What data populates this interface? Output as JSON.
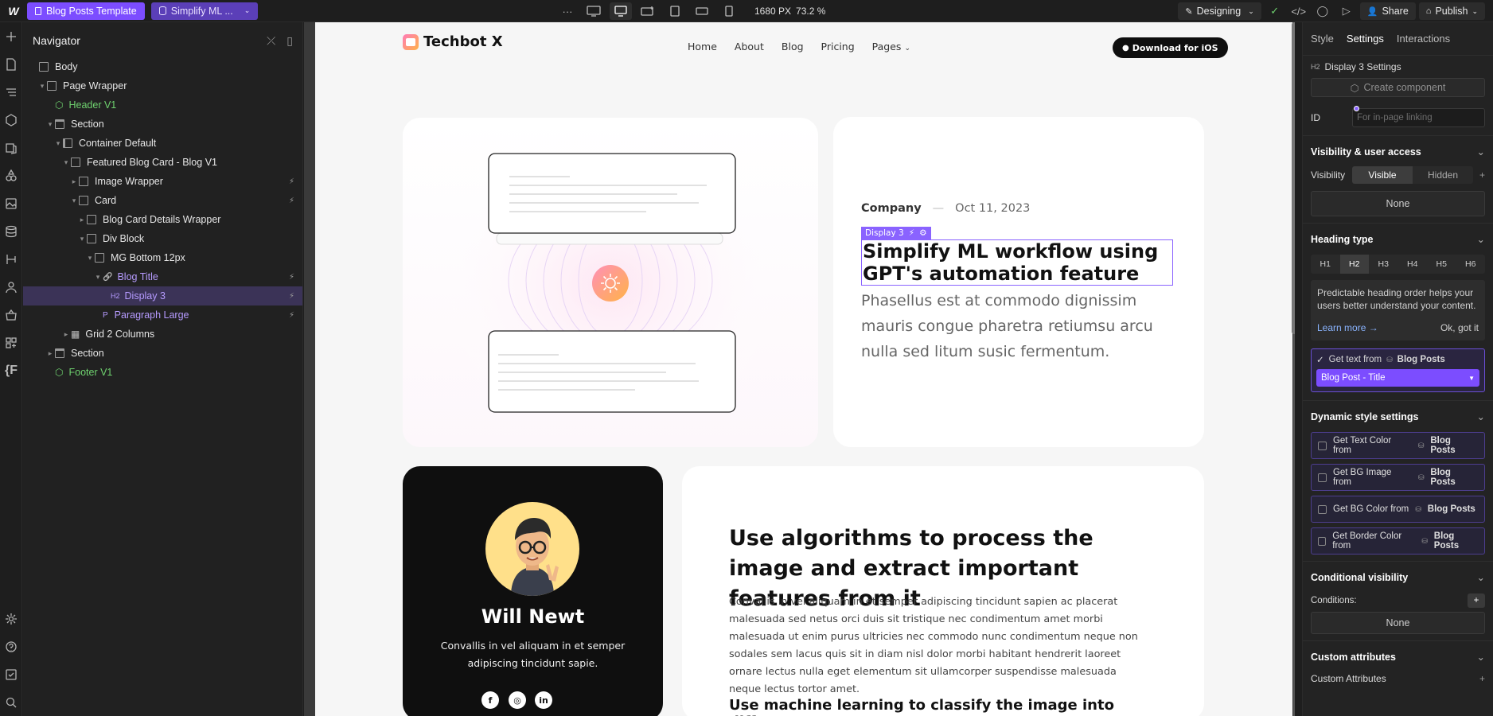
{
  "topbar": {
    "page_name": "Blog Posts Template",
    "collection_name": "Simplify ML ...",
    "more": "···",
    "viewport_width": "1680 PX",
    "zoom": "73.2 %",
    "mode": "Designing",
    "share": "Share",
    "publish": "Publish"
  },
  "navigator": {
    "title": "Navigator",
    "rows": [
      {
        "label": "Body",
        "indent": 0,
        "caret": "",
        "kind": "box",
        "color": "white",
        "bolt": false,
        "selected": false
      },
      {
        "label": "Page Wrapper",
        "indent": 1,
        "caret": "▾",
        "kind": "box",
        "color": "white",
        "bolt": false,
        "selected": false
      },
      {
        "label": "Header V1",
        "indent": 2,
        "caret": "",
        "kind": "component",
        "color": "green",
        "bolt": false,
        "selected": false
      },
      {
        "label": "Section",
        "indent": 2,
        "caret": "▾",
        "kind": "section",
        "color": "white",
        "bolt": false,
        "selected": false
      },
      {
        "label": "Container Default",
        "indent": 3,
        "caret": "▾",
        "kind": "container",
        "color": "white",
        "bolt": false,
        "selected": false
      },
      {
        "label": "Featured Blog Card - Blog V1",
        "indent": 4,
        "caret": "▾",
        "kind": "box",
        "color": "white",
        "bolt": false,
        "selected": false
      },
      {
        "label": "Image Wrapper",
        "indent": 5,
        "caret": "▸",
        "kind": "box",
        "color": "white",
        "bolt": true,
        "selected": false
      },
      {
        "label": "Card",
        "indent": 5,
        "caret": "▾",
        "kind": "box",
        "color": "white",
        "bolt": true,
        "selected": false
      },
      {
        "label": "Blog Card Details Wrapper",
        "indent": 6,
        "caret": "▸",
        "kind": "box",
        "color": "white",
        "bolt": false,
        "selected": false
      },
      {
        "label": "Div Block",
        "indent": 6,
        "caret": "▾",
        "kind": "box",
        "color": "white",
        "bolt": false,
        "selected": false
      },
      {
        "label": "MG Bottom 12px",
        "indent": 7,
        "caret": "▾",
        "kind": "box",
        "color": "white",
        "bolt": false,
        "selected": false
      },
      {
        "label": "Blog Title",
        "indent": 8,
        "caret": "▾",
        "kind": "link",
        "color": "purple",
        "bolt": true,
        "selected": false
      },
      {
        "label": "Display 3",
        "indent": 9,
        "caret": "",
        "kind": "h2",
        "color": "purple",
        "bolt": true,
        "selected": true
      },
      {
        "label": "Paragraph Large",
        "indent": 8,
        "caret": "",
        "kind": "p",
        "color": "purple",
        "bolt": true,
        "selected": false
      },
      {
        "label": "Grid 2 Columns",
        "indent": 4,
        "caret": "▸",
        "kind": "grid",
        "color": "white",
        "bolt": false,
        "selected": false
      },
      {
        "label": "Section",
        "indent": 2,
        "caret": "▸",
        "kind": "section",
        "color": "white",
        "bolt": false,
        "selected": false
      },
      {
        "label": "Footer V1",
        "indent": 2,
        "caret": "",
        "kind": "component",
        "color": "green",
        "bolt": false,
        "selected": false
      }
    ]
  },
  "site": {
    "brand": "Techbot X",
    "links": [
      "Home",
      "About",
      "Blog",
      "Pricing",
      "Pages"
    ],
    "download": "Download for iOS",
    "featured": {
      "category": "Company",
      "separator": "—",
      "date": "Oct 11, 2023",
      "selected_tag": "Display 3",
      "title": "Simplify ML workflow using GPT's automation feature",
      "paragraph": "Phasellus est at commodo dignissim mauris congue pharetra retiumsu arcu nulla sed litum susic fermentum."
    },
    "author": {
      "name": "Will Newt",
      "bio": "Convallis in vel aliquam in et semper adipiscing tincidunt sapie."
    },
    "article": {
      "heading": "Use algorithms to process the image and extract important features from it",
      "body": "Convallis in vel aliquam in et semper adipiscing tincidunt sapien ac placerat malesuada sed netus orci duis sit tristique nec condimentum amet morbi malesuada ut enim purus ultricies nec commodo nunc condimentum neque non sodales sem lacus quis sit in diam nisl dolor morbi habitant hendrerit laoreet ornare lectus nulla eget elementum sit ullamcorper suspendisse malesuada neque lectus tortor amet.",
      "subheading": "Use machine learning to classify the image into different"
    }
  },
  "panel": {
    "tabs": [
      "Style",
      "Settings",
      "Interactions"
    ],
    "element": "Display 3 Settings",
    "create_component": "Create component",
    "id_label": "ID",
    "id_placeholder": "For in-page linking",
    "visibility_section": "Visibility & user access",
    "visibility_label": "Visibility",
    "visible": "Visible",
    "hidden": "Hidden",
    "none": "None",
    "heading_type": "Heading type",
    "headings": [
      "H1",
      "H2",
      "H3",
      "H4",
      "H5",
      "H6"
    ],
    "info_text": "Predictable heading order helps your users better understand your content.",
    "learn_more": "Learn more →",
    "ok": "Ok, got it",
    "get_text_from": "Get text from",
    "collection": "Blog Posts",
    "field": "Blog Post - Title",
    "dynamic_section": "Dynamic style settings",
    "dynamic": [
      "Get Text Color from",
      "Get BG Image from",
      "Get BG Color from",
      "Get Border Color from"
    ],
    "conditional_section": "Conditional visibility",
    "conditions": "Conditions:",
    "custom_section": "Custom attributes",
    "custom_attributes": "Custom Attributes"
  },
  "colors": {
    "accent": "#7c4dff",
    "green": "#6fd26f",
    "select": "#8a63ff"
  }
}
